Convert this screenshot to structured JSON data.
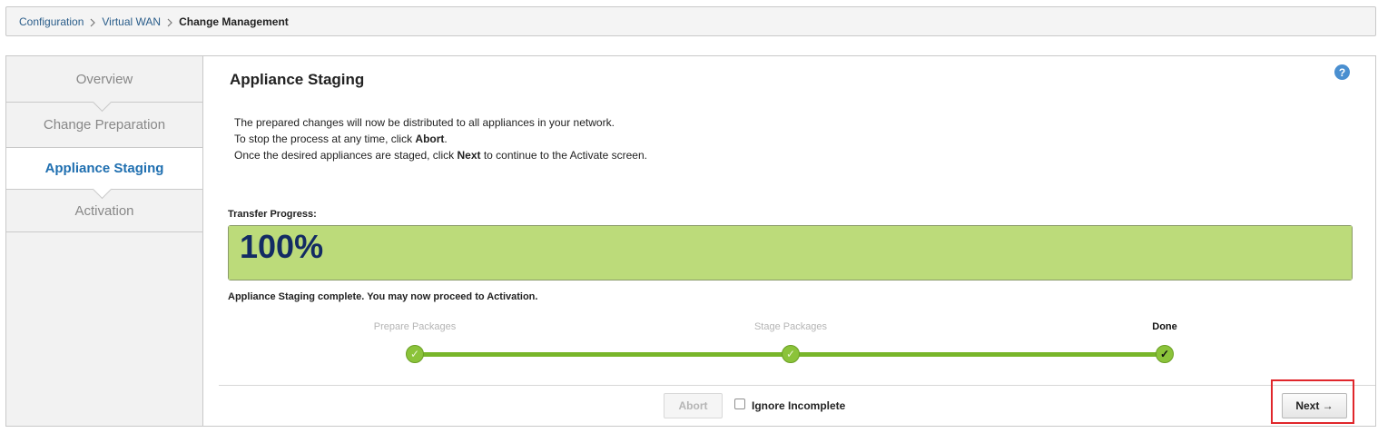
{
  "breadcrumb": {
    "items": [
      "Configuration",
      "Virtual WAN",
      "Change Management"
    ]
  },
  "sidebar": {
    "steps": [
      "Overview",
      "Change Preparation",
      "Appliance Staging",
      "Activation"
    ],
    "active_index": 2
  },
  "main": {
    "title": "Appliance Staging",
    "help_label": "?",
    "description": {
      "line1": "The prepared changes will now be distributed to all appliances in your network.",
      "line2_prefix": "To stop the process at any time, click ",
      "line2_bold": "Abort",
      "line2_suffix": ".",
      "line3_prefix": "Once the desired appliances are staged, click ",
      "line3_bold": "Next",
      "line3_suffix": " to continue to the Activate screen."
    },
    "progress": {
      "label": "Transfer Progress:",
      "value_text": "100%",
      "value": 100
    },
    "status_message": "Appliance Staging complete. You may now proceed to Activation.",
    "stages": [
      {
        "label": "Prepare Packages",
        "state": "complete"
      },
      {
        "label": "Stage Packages",
        "state": "complete"
      },
      {
        "label": "Done",
        "state": "current"
      }
    ],
    "check_mark": "✓",
    "footer": {
      "abort_label": "Abort",
      "ignore_incomplete_label": "Ignore Incomplete",
      "next_label": "Next →"
    }
  },
  "colors": {
    "progress_fill": "#bcdb7a",
    "progress_text": "#132b63",
    "stage_green": "#8bc33a",
    "active_step": "#1f6fb0",
    "highlight": "#e0262b"
  }
}
